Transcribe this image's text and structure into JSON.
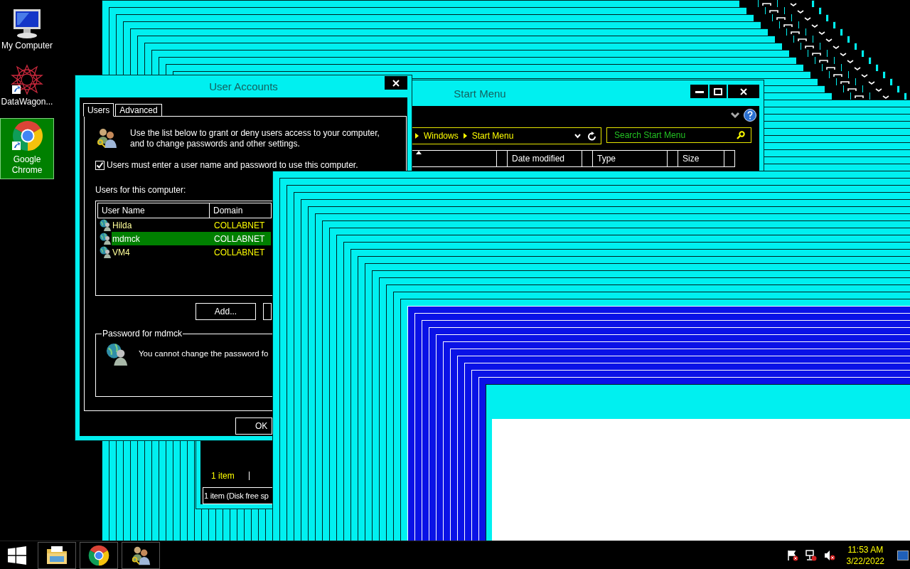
{
  "desktop_icons": [
    {
      "kind": "computer",
      "label": "My Computer",
      "selected": false
    },
    {
      "kind": "datawagon",
      "label": "DataWagon...",
      "selected": false
    },
    {
      "kind": "chrome",
      "label": "Google Chrome",
      "selected": true
    }
  ],
  "explorer_window": {
    "title": "Start Menu",
    "breadcrumbs": [
      "Windows",
      "Start Menu"
    ],
    "search": {
      "placeholder": "Search Start Menu"
    },
    "columns": [
      "Date modified",
      "Type",
      "Size"
    ],
    "item_count": "1 item",
    "status_bar": "1 item (Disk free sp"
  },
  "user_accounts": {
    "title": "User Accounts",
    "tabs": [
      {
        "label": "Users",
        "selected": true
      },
      {
        "label": "Advanced",
        "selected": false
      }
    ],
    "intro": "Use the list below to grant or deny users access to your computer, and to change passwords and other settings.",
    "require_password": {
      "label": "Users must enter a user name and password to use this computer.",
      "checked": true
    },
    "users_label": "Users for this computer:",
    "columns": [
      "User Name",
      "Domain"
    ],
    "users": [
      {
        "name": "Hilda",
        "domain": "COLLABNET",
        "selected": false
      },
      {
        "name": "mdmck",
        "domain": "COLLABNET",
        "selected": true
      },
      {
        "name": "VM4",
        "domain": "COLLABNET",
        "selected": false
      }
    ],
    "add_button": "Add...",
    "password_group": {
      "title": "Password for mdmck",
      "message": "You cannot change the password fo"
    },
    "ok_button": "OK"
  },
  "taskbar": {
    "apps": [
      {
        "kind": "explorer"
      },
      {
        "kind": "chrome"
      },
      {
        "kind": "users"
      }
    ],
    "clock": {
      "time": "11:53 AM",
      "date": "3/22/2022"
    }
  }
}
